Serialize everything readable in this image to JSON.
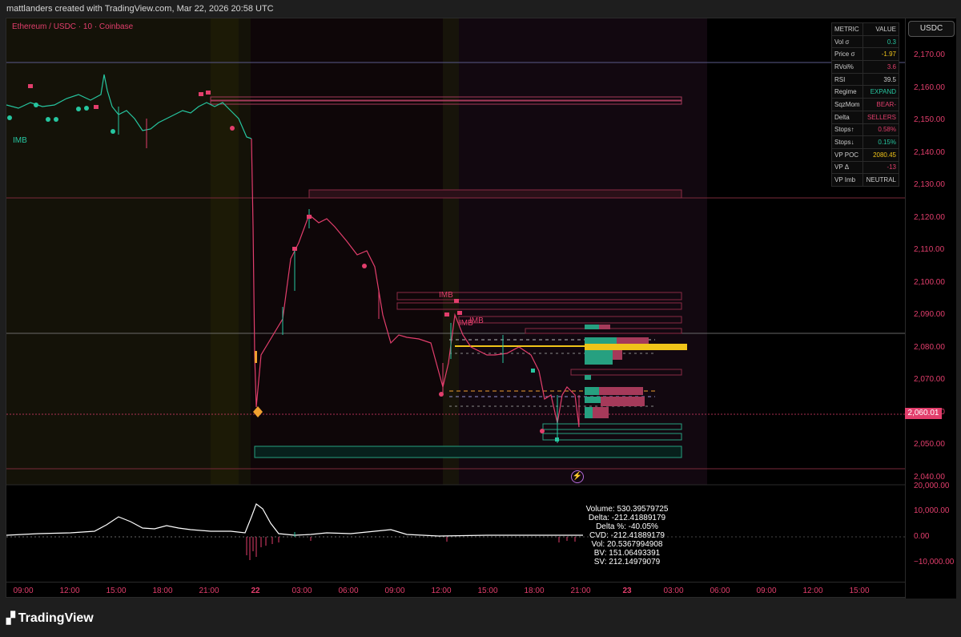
{
  "header": {
    "text": "mattlanders created with TradingView.com, Mar 22, 2026 20:58 UTC"
  },
  "symbol": {
    "text": "Ethereum / USDC · 10 · Coinbase"
  },
  "currency_button": {
    "label": "USDC"
  },
  "current_price": {
    "label": "2,060.01"
  },
  "price_axis": {
    "labels": [
      "2,170.00",
      "2,160.00",
      "2,150.00",
      "2,140.00",
      "2,130.00",
      "2,120.00",
      "2,110.00",
      "2,100.00",
      "2,090.00",
      "2,080.00",
      "2,070.00",
      "2,060.00",
      "2,050.00",
      "2,040.00"
    ]
  },
  "volume_axis": {
    "labels": [
      "20,000.00",
      "10,000.00",
      "0.00",
      "−10,000.00"
    ]
  },
  "time_axis": {
    "labels": [
      "09:00",
      "12:00",
      "15:00",
      "18:00",
      "21:00",
      "22",
      "03:00",
      "06:00",
      "09:00",
      "12:00",
      "15:00",
      "18:00",
      "21:00",
      "23",
      "03:00",
      "06:00",
      "09:00",
      "12:00",
      "15:00"
    ]
  },
  "metrics": {
    "header": [
      "METRIC",
      "VALUE"
    ],
    "rows": [
      {
        "metric": "Vol σ",
        "value": "0.3",
        "color": "#26c6a0"
      },
      {
        "metric": "Price σ",
        "value": "-1.97",
        "color": "#f0c419"
      },
      {
        "metric": "RVol%",
        "value": "3.6",
        "color": "#e23e6c"
      },
      {
        "metric": "RSI",
        "value": "39.5",
        "color": "#cccccc"
      },
      {
        "metric": "Regime",
        "value": "EXPAND",
        "color": "#26c6a0"
      },
      {
        "metric": "SqzMom",
        "value": "BEAR-",
        "color": "#e23e6c"
      },
      {
        "metric": "Delta",
        "value": "SELLERS",
        "color": "#e23e6c"
      },
      {
        "metric": "Stops↑",
        "value": "0.58%",
        "color": "#e23e6c"
      },
      {
        "metric": "Stops↓",
        "value": "0.15%",
        "color": "#26c6a0"
      },
      {
        "metric": "VP POC",
        "value": "2080.45",
        "color": "#f0c419"
      },
      {
        "metric": "VP Δ",
        "value": "-13",
        "color": "#e23e6c"
      },
      {
        "metric": "VP Imb",
        "value": "NEUTRAL",
        "color": "#cccccc"
      }
    ]
  },
  "stats": {
    "lines": [
      "Volume: 530.39579725",
      "Delta: -212.41889179",
      "Delta %: -40.05%",
      "CVD: -212.41889179",
      "Vol: 20.5367994908",
      "BV: 151.06493391",
      "SV: 212.14979079"
    ]
  },
  "annotations": {
    "imb1": "IMB",
    "imb2": "IMB",
    "imb3": "IMB",
    "imb4": "IMB"
  },
  "branding": {
    "text": "TradingView"
  },
  "colors": {
    "bull": "#26c6a0",
    "bear": "#e23e6c",
    "poc": "#f0c419"
  }
}
